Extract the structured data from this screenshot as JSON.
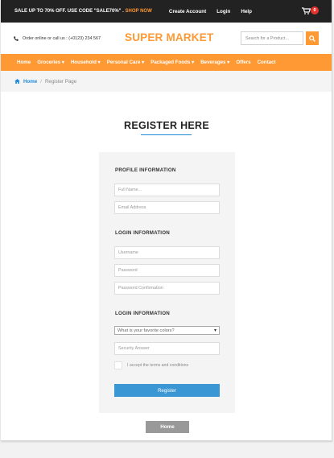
{
  "topbar": {
    "promo": "SALE UP TO 70% OFF. USE CODE \"SALE70%\" .",
    "shop_now": "SHOP NOW",
    "links": [
      "Create Account",
      "Login",
      "Help"
    ],
    "cart_count": "0"
  },
  "header": {
    "contact": "Order online or call us : (+0123) 234 567",
    "brand": "SUPER MARKET",
    "search_placeholder": "Search for a Product..."
  },
  "nav": {
    "items": [
      "Home",
      "Groceries",
      "Household",
      "Personal Care",
      "Packaged Foods",
      "Beverages",
      "Offers",
      "Contact"
    ]
  },
  "breadcrumb": {
    "home": "Home",
    "separator": "/",
    "current": "Register Page"
  },
  "register": {
    "title": "REGISTER HERE",
    "profile_heading": "PROFILE INFORMATION",
    "full_name_placeholder": "Full Name...",
    "email_placeholder": "Email Address",
    "login_heading": "LOGIN INFORMATION",
    "username_placeholder": "Username",
    "password_placeholder": "Password",
    "password_confirm_placeholder": "Password Confirmation",
    "login_heading_2": "LOGIN INFORMATION",
    "security_question": "What is your favorite colors?",
    "security_answer_placeholder": "Security Answer",
    "terms": "I accept the terms and conditions",
    "register_button": "Register"
  },
  "footer": {
    "home_button": "Home"
  },
  "colors": {
    "accent": "#ff9933",
    "topbar": "#222222",
    "link": "#1d8ad8",
    "button": "#3b97d3"
  }
}
